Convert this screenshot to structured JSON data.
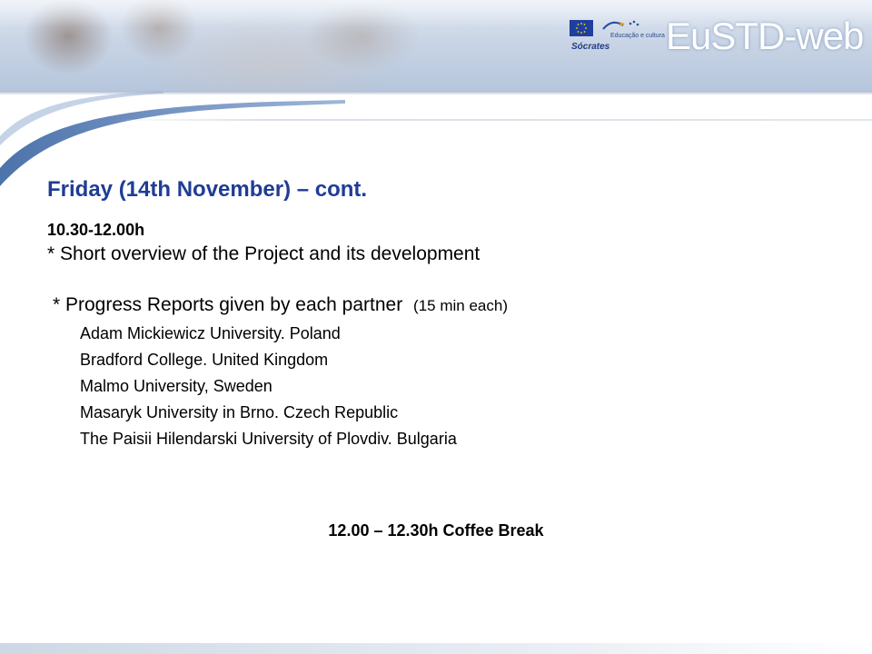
{
  "header": {
    "site_title": "EuSTD-web",
    "program_name": "Sócrates",
    "sub_logo_text": "Educação e cultura",
    "icons": [
      "eu-flag-icon",
      "erasmus-logo-icon"
    ]
  },
  "slide": {
    "heading": "Friday (14th November) – cont.",
    "time": "10.30-12.00h",
    "bullet_overview": "* Short overview of the Project and its development",
    "bullet_reports": "* Progress Reports given by each partner",
    "reports_note": "(15 min each)",
    "partners": [
      "Adam Mickiewicz University. Poland",
      "Bradford College. United Kingdom",
      "Malmo University, Sweden",
      "Masaryk University in Brno. Czech Republic",
      "The Paisii Hilendarski University of Plovdiv. Bulgaria"
    ],
    "coffee_break": "12.00 – 12.30h Coffee Break"
  },
  "colors": {
    "heading": "#1f3c96",
    "banner": "#c9d5e6",
    "swoosh": "#3f6aa8"
  }
}
